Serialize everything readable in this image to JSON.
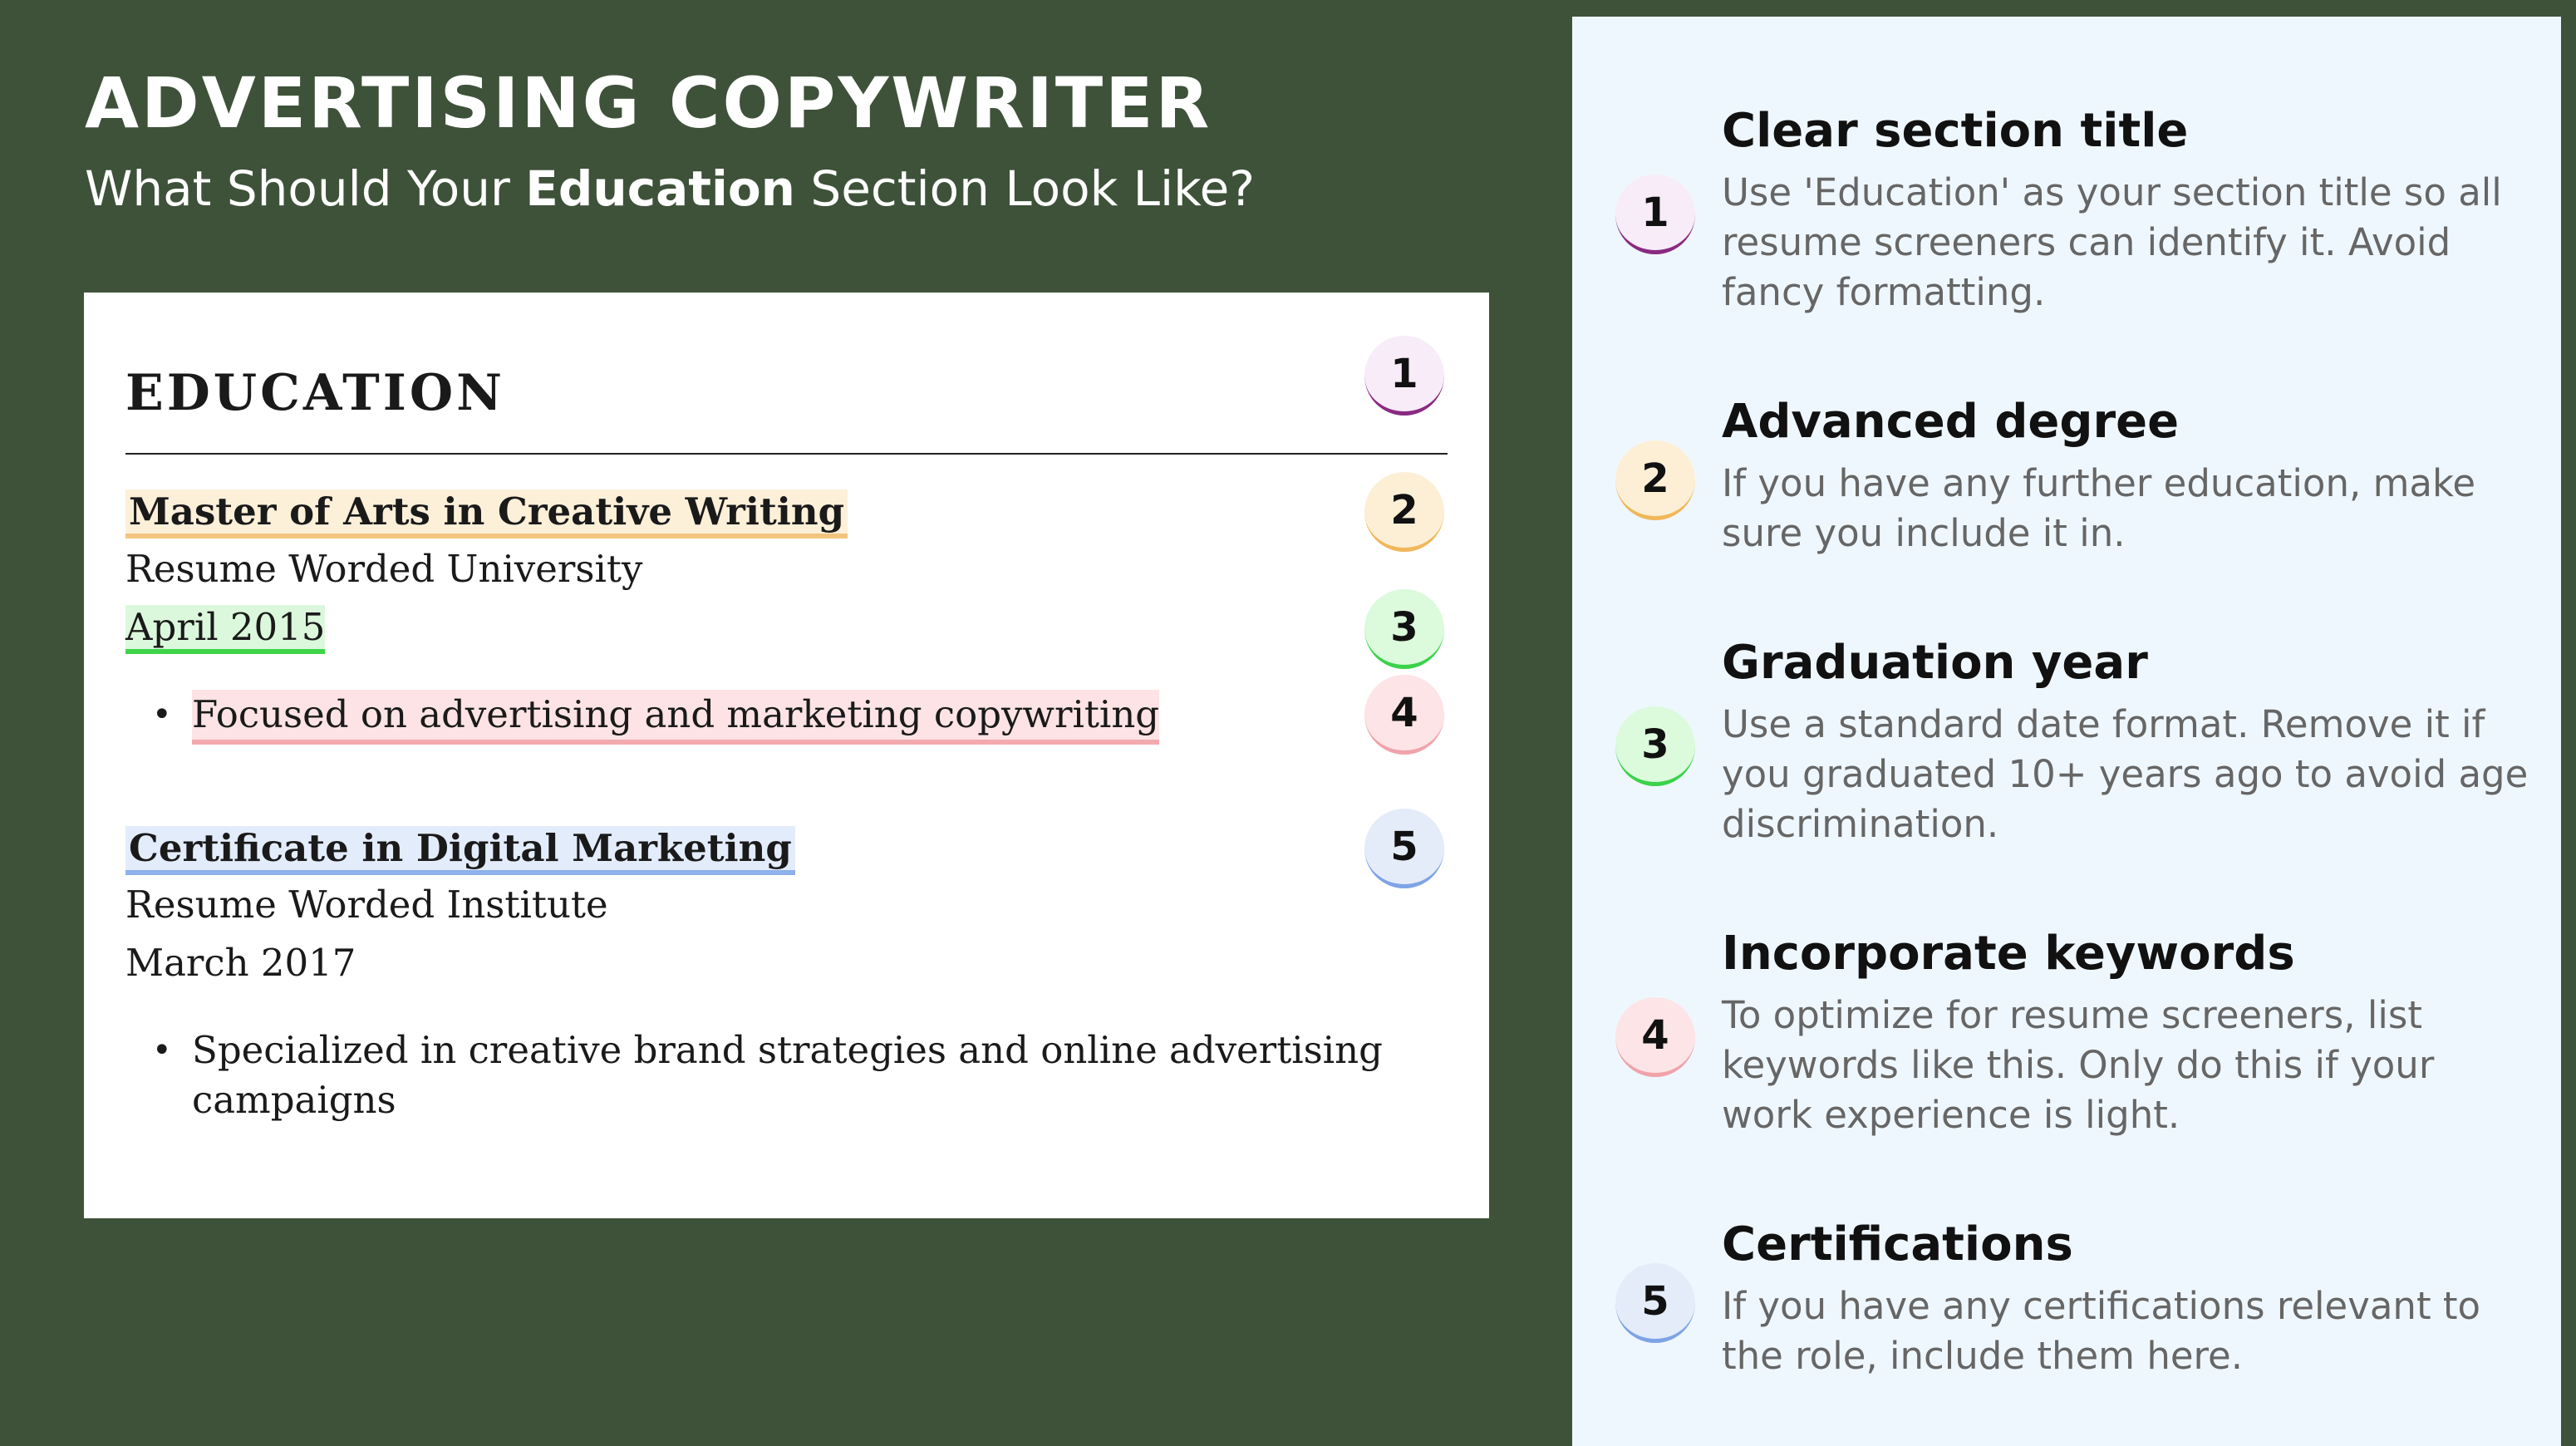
{
  "header": {
    "title": "ADVERTISING COPYWRITER",
    "subtitle_before": "What Should Your ",
    "subtitle_bold": "Education",
    "subtitle_after": " Section Look Like?"
  },
  "resume": {
    "heading": "EDUCATION",
    "entries": [
      {
        "degree": "Master of Arts in Creative Writing",
        "school": "Resume Worded University",
        "date": "April 2015",
        "bullet": "Focused on advertising and marketing copywriting"
      },
      {
        "degree": "Certificate in Digital Marketing",
        "school": "Resume Worded Institute",
        "date": "March 2017",
        "bullet_line1": "Specialized in creative brand strategies and online advertising",
        "bullet_line2": "campaigns"
      }
    ],
    "bullet_glyph": "•",
    "badges": [
      "1",
      "2",
      "3",
      "4",
      "5"
    ]
  },
  "tips": [
    {
      "number": "1",
      "title": "Clear section title",
      "description": "Use 'Education' as your section title so all resume screeners can identify it. Avoid fancy formatting."
    },
    {
      "number": "2",
      "title": "Advanced degree",
      "description": "If you have any further education, make sure you include it in."
    },
    {
      "number": "3",
      "title": "Graduation year",
      "description": "Use a standard date format. Remove it if you graduated 10+ years ago to avoid age discrimination."
    },
    {
      "number": "4",
      "title": "Incorporate keywords",
      "description": "To optimize for resume screeners, list keywords like this. Only do this if your work experience is light."
    },
    {
      "number": "5",
      "title": "Certifications",
      "description": "If you have any certifications relevant to the role, include them here."
    }
  ],
  "colors": {
    "background": "#3e523a",
    "panel": "#eff7fe",
    "badge_1": "#8a2a82",
    "badge_2": "#f0b85a",
    "badge_3": "#3bd24a",
    "badge_4": "#f0a3aa",
    "badge_5": "#7fa3e6"
  }
}
